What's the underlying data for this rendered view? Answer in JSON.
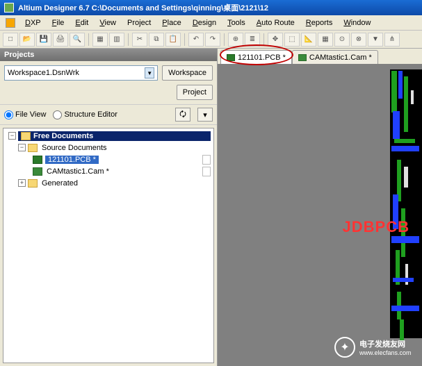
{
  "title": "Altium Designer 6.7   C:\\Documents and Settings\\qinning\\桌面\\2121\\12",
  "menu": {
    "items": [
      "DXP",
      "File",
      "Edit",
      "View",
      "Project",
      "Place",
      "Design",
      "Tools",
      "Auto Route",
      "Reports",
      "Window"
    ]
  },
  "panel": {
    "title": "Projects",
    "workspace": "Workspace1.DsnWrk",
    "workspace_btn": "Workspace",
    "project_btn": "Project",
    "view_file": "File View",
    "view_struct": "Structure Editor"
  },
  "tree": {
    "root": "Free Documents",
    "node1": "Source Documents",
    "leaf1": "121101.PCB *",
    "leaf2": "CAMtastic1.Cam *",
    "node2": "Generated"
  },
  "tabs": {
    "t1": "121101.PCB *",
    "t2": "CAMtastic1.Cam *"
  },
  "overlay": "JDBPCB",
  "watermark": {
    "text": "电子发烧友网",
    "url": "www.elecfans.com"
  }
}
